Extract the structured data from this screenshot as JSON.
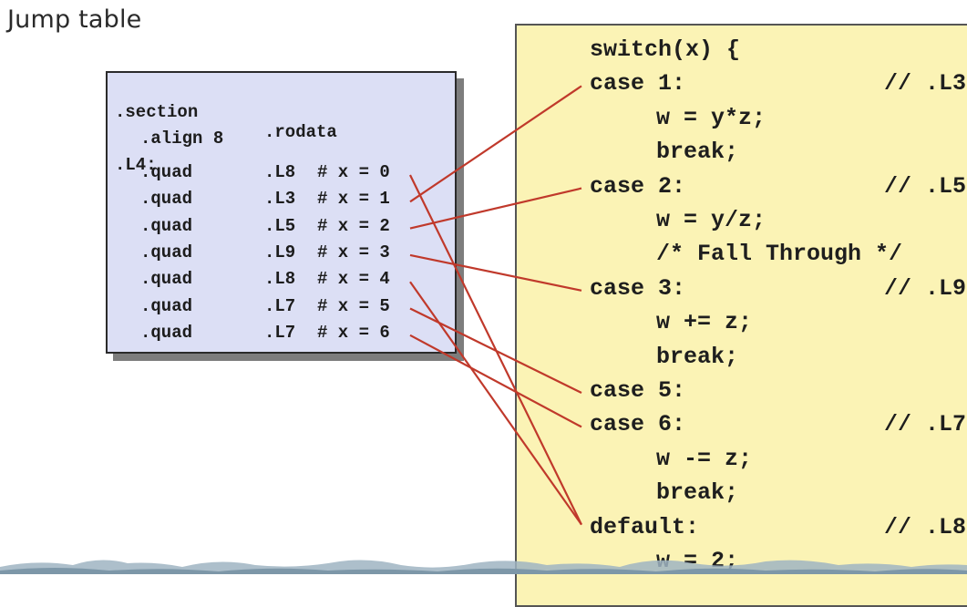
{
  "title": "Jump table",
  "jump_table": {
    "header": {
      "directive": ".section",
      "arg": ".rodata"
    },
    "align": ".align 8",
    "label": ".L4:",
    "entries": [
      {
        "op": ".quad",
        "target": ".L8",
        "comment": "# x = 0"
      },
      {
        "op": ".quad",
        "target": ".L3",
        "comment": "# x = 1"
      },
      {
        "op": ".quad",
        "target": ".L5",
        "comment": "# x = 2"
      },
      {
        "op": ".quad",
        "target": ".L9",
        "comment": "# x = 3"
      },
      {
        "op": ".quad",
        "target": ".L8",
        "comment": "# x = 4"
      },
      {
        "op": ".quad",
        "target": ".L7",
        "comment": "# x = 5"
      },
      {
        "op": ".quad",
        "target": ".L7",
        "comment": "# x = 6"
      }
    ]
  },
  "code": {
    "lines": [
      {
        "text": "switch(x) {",
        "indent": 0,
        "comment": ""
      },
      {
        "text": "case 1:",
        "indent": 0,
        "comment": "// .L3"
      },
      {
        "text": "w = y*z;",
        "indent": 1,
        "comment": ""
      },
      {
        "text": "break;",
        "indent": 1,
        "comment": ""
      },
      {
        "text": "case 2:",
        "indent": 0,
        "comment": "// .L5"
      },
      {
        "text": "w = y/z;",
        "indent": 1,
        "comment": ""
      },
      {
        "text": "/* Fall Through */",
        "indent": 1,
        "comment": ""
      },
      {
        "text": "case 3:",
        "indent": 0,
        "comment": "// .L9"
      },
      {
        "text": "w += z;",
        "indent": 1,
        "comment": ""
      },
      {
        "text": "break;",
        "indent": 1,
        "comment": ""
      },
      {
        "text": "case 5:",
        "indent": 0,
        "comment": ""
      },
      {
        "text": "case 6:",
        "indent": 0,
        "comment": "// .L7"
      },
      {
        "text": "w -= z;",
        "indent": 1,
        "comment": ""
      },
      {
        "text": "break;",
        "indent": 1,
        "comment": ""
      },
      {
        "text": "default:",
        "indent": 0,
        "comment": "// .L8"
      },
      {
        "text": "w = 2;",
        "indent": 1,
        "comment": ""
      }
    ]
  },
  "connections": [
    {
      "from_entry": 0,
      "to_line": 14
    },
    {
      "from_entry": 1,
      "to_line": 1
    },
    {
      "from_entry": 2,
      "to_line": 4
    },
    {
      "from_entry": 3,
      "to_line": 7
    },
    {
      "from_entry": 4,
      "to_line": 14
    },
    {
      "from_entry": 5,
      "to_line": 10
    },
    {
      "from_entry": 6,
      "to_line": 11
    }
  ],
  "colors": {
    "table_bg": "#dcdff5",
    "code_bg": "#fbf3b5",
    "wire": "#c0392b"
  }
}
